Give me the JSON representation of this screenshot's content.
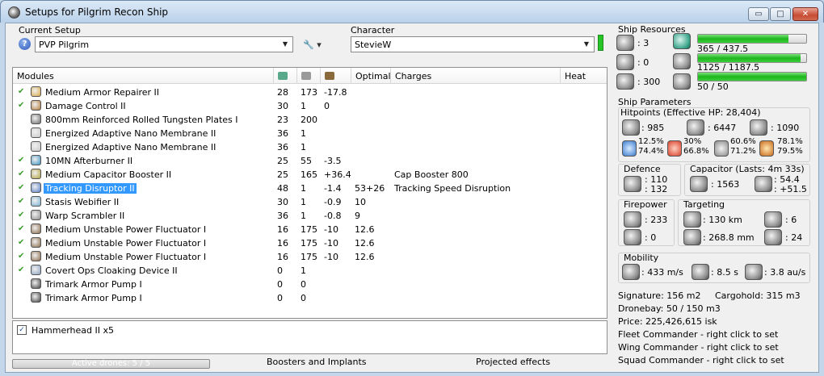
{
  "window": {
    "title": "Setups for Pilgrim Recon Ship",
    "buttons": {
      "minimize": "▭",
      "maximize": "□",
      "close": "✕"
    }
  },
  "setup": {
    "label": "Current Setup",
    "value": "PVP Pilgrim",
    "help_glyph": "?",
    "tool_glyph": "🔧 ▾"
  },
  "character": {
    "label": "Character",
    "value": "StevieW"
  },
  "modules": {
    "headers": {
      "name": "Modules",
      "optimal": "Optimal",
      "charges": "Charges",
      "heat": "Heat"
    },
    "rows": [
      {
        "checked": true,
        "name": "Medium Armor Repairer II",
        "c1": "28",
        "c2": "173",
        "c3": "-17.8",
        "optimal": "",
        "charges": ""
      },
      {
        "checked": true,
        "name": "Damage Control II",
        "c1": "30",
        "c2": "1",
        "c3": "0",
        "optimal": "",
        "charges": ""
      },
      {
        "checked": false,
        "name": "800mm Reinforced Rolled Tungsten Plates I",
        "c1": "23",
        "c2": "200",
        "c3": "",
        "optimal": "",
        "charges": ""
      },
      {
        "checked": false,
        "name": "Energized Adaptive Nano Membrane II",
        "c1": "36",
        "c2": "1",
        "c3": "",
        "optimal": "",
        "charges": ""
      },
      {
        "checked": false,
        "name": "Energized Adaptive Nano Membrane II",
        "c1": "36",
        "c2": "1",
        "c3": "",
        "optimal": "",
        "charges": ""
      },
      {
        "checked": true,
        "name": "10MN Afterburner II",
        "c1": "25",
        "c2": "55",
        "c3": "-3.5",
        "optimal": "",
        "charges": ""
      },
      {
        "checked": true,
        "name": "Medium Capacitor Booster II",
        "c1": "25",
        "c2": "165",
        "c3": "+36.4",
        "optimal": "",
        "charges": "Cap Booster 800"
      },
      {
        "checked": true,
        "name": "Tracking Disruptor II",
        "c1": "48",
        "c2": "1",
        "c3": "-1.4",
        "optimal": "53+26",
        "charges": "Tracking Speed Disruption",
        "selected": true
      },
      {
        "checked": true,
        "name": "Stasis Webifier II",
        "c1": "30",
        "c2": "1",
        "c3": "-0.9",
        "optimal": "10",
        "charges": ""
      },
      {
        "checked": true,
        "name": "Warp Scrambler II",
        "c1": "36",
        "c2": "1",
        "c3": "-0.8",
        "optimal": "9",
        "charges": ""
      },
      {
        "checked": true,
        "name": "Medium Unstable Power Fluctuator I",
        "c1": "16",
        "c2": "175",
        "c3": "-10",
        "optimal": "12.6",
        "charges": ""
      },
      {
        "checked": true,
        "name": "Medium Unstable Power Fluctuator I",
        "c1": "16",
        "c2": "175",
        "c3": "-10",
        "optimal": "12.6",
        "charges": ""
      },
      {
        "checked": true,
        "name": "Medium Unstable Power Fluctuator I",
        "c1": "16",
        "c2": "175",
        "c3": "-10",
        "optimal": "12.6",
        "charges": ""
      },
      {
        "checked": true,
        "name": "Covert Ops Cloaking Device II",
        "c1": "0",
        "c2": "1",
        "c3": "",
        "optimal": "",
        "charges": ""
      },
      {
        "checked": false,
        "name": "Trimark Armor Pump I",
        "c1": "0",
        "c2": "0",
        "c3": "",
        "optimal": "",
        "charges": ""
      },
      {
        "checked": false,
        "name": "Trimark Armor Pump I",
        "c1": "0",
        "c2": "0",
        "c3": "",
        "optimal": "",
        "charges": ""
      }
    ]
  },
  "drones": {
    "checked": true,
    "label": "Hammerhead II x5",
    "check_glyph": "✓"
  },
  "bottom": {
    "active_drones": "Active drones: 5 / 5",
    "boosters": "Boosters and Implants",
    "projected": "Projected effects"
  },
  "resources": {
    "title": "Ship Resources",
    "slots": {
      "turret": ": 3",
      "launcher": ": 0",
      "drone": ": 300"
    },
    "cpu": {
      "text": "365 / 437.5",
      "fraction": 0.834
    },
    "powergrid": {
      "text": "1125 / 1187.5",
      "fraction": 0.947
    },
    "drone_bw": {
      "text": "50 / 50",
      "fraction": 1.0
    }
  },
  "parameters": {
    "title": "Ship Parameters",
    "hitpoints": {
      "title": "Hitpoints (Effective HP: 28,404)",
      "shield": ": 985",
      "armor": ": 6447",
      "structure": ": 1090",
      "em": [
        "12.5%",
        "74.4%"
      ],
      "thermal": [
        "30%",
        "66.8%"
      ],
      "kinetic": [
        "60.6%",
        "71.2%"
      ],
      "explosive": [
        "78.1%",
        "79.5%"
      ]
    },
    "defence": {
      "title": "Defence",
      "v1": ": 110",
      "v2": ": 132"
    },
    "capacitor": {
      "title": "Capacitor (Lasts: 4m 33s)",
      "amount": ": 1563",
      "v1": ": 54.4",
      "v2": ": +51.5"
    },
    "firepower": {
      "title": "Firepower",
      "turret": ": 233",
      "missile": ": 0"
    },
    "targeting": {
      "title": "Targeting",
      "range": ": 130 km",
      "targets": ": 6",
      "resolution": ": 268.8 mm",
      "sensor": ": 24"
    },
    "mobility": {
      "title": "Mobility",
      "speed": ": 433 m/s",
      "align": ": 8.5 s",
      "warp": ": 3.8 au/s"
    }
  },
  "info": {
    "signature": "Signature: 156 m2",
    "cargohold": "Cargohold: 315 m3",
    "dronebay": "Dronebay: 50 / 150 m3",
    "price": "Price: 225,426,615 isk",
    "fleet": "Fleet Commander - right click to set",
    "wing": "Wing Commander - right click to set",
    "squad": "Squad Commander - right click to set"
  }
}
